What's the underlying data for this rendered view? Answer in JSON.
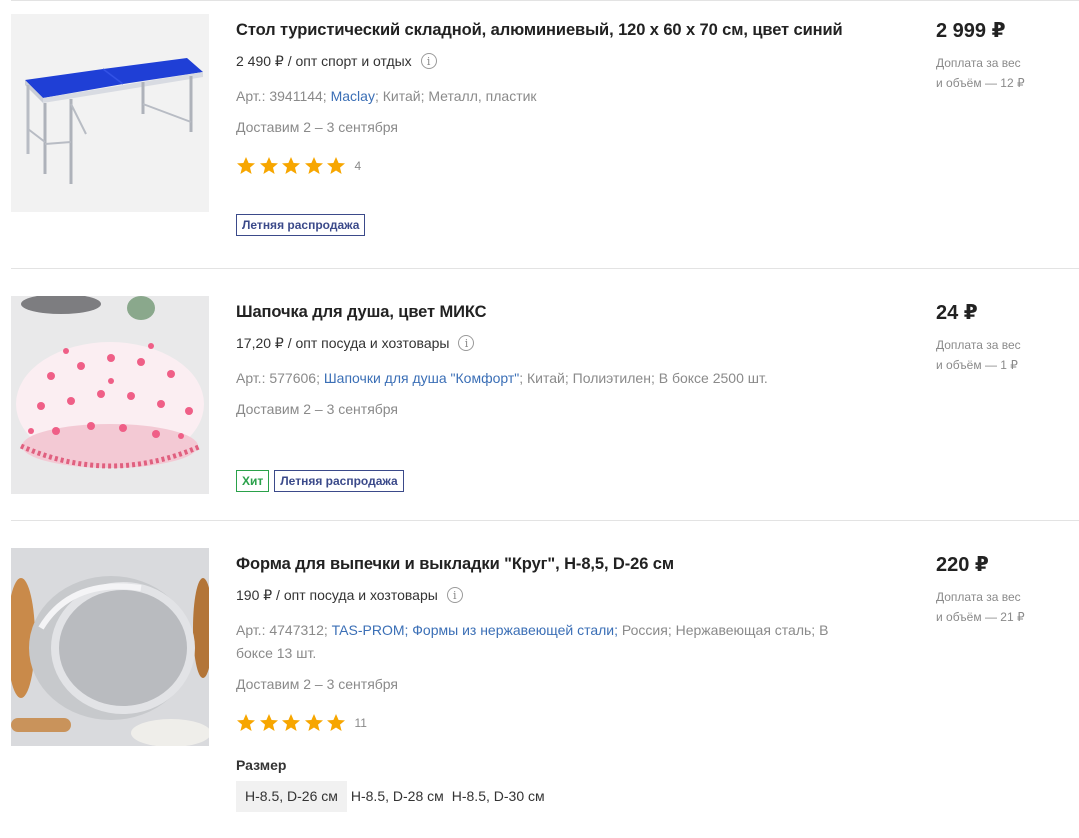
{
  "currency_sign": "₽",
  "products": [
    {
      "title": "Стол туристический складной, алюминиевый, 120 х 60 х 70 см, цвет синий",
      "opt_price": "2 490 ₽ / опт спорт и отдых",
      "info_glyph": "i",
      "article": "Арт.: 3941144;",
      "brand": "Maclay",
      "country": "Китай;",
      "material": "Металл, пластик",
      "delivery": "Доставим 2 – 3 сентября",
      "rating": 5,
      "rating_count": "4",
      "badges": [
        "Летняя распродажа"
      ],
      "price": "2 999 ₽",
      "surcharge_line1": "Доплата за вес",
      "surcharge_line2": "и объём — 12 ₽"
    },
    {
      "title": "Шапочка для душа, цвет МИКС",
      "opt_price": "17,20 ₽ / опт посуда и хозтовары",
      "info_glyph": "i",
      "article": "Арт.: 577606;",
      "brand": "Шапочки для душа \"Комфорт\"",
      "country": "Китай;",
      "material": "Полиэтилен;",
      "box": "В боксе 2500 шт.",
      "delivery": "Доставим 2 – 3 сентября",
      "badge_hit": "Хит",
      "badge_sale": "Летняя распродажа",
      "price": "24 ₽",
      "surcharge_line1": "Доплата за вес",
      "surcharge_line2": "и объём — 1 ₽"
    },
    {
      "title": "Форма для выпечки и выкладки \"Круг\", H-8,5, D-26 см",
      "opt_price": "190 ₽ / опт посуда и хозтовары",
      "info_glyph": "i",
      "article": "Арт.: 4747312;",
      "brand": "TAS-PROM;",
      "category": "Формы из нержавеющей стали;",
      "country": "Россия;",
      "material": "Нержавеющая сталь;",
      "box": "В боксе 13 шт.",
      "delivery": "Доставим 2 – 3 сентября",
      "rating": 5,
      "rating_count": "11",
      "size_label": "Размер",
      "sizes": [
        "H-8.5, D-26 см",
        "H-8.5, D-28 см",
        "H-8.5, D-30 см"
      ],
      "selected_size": "H-8.5, D-26 см",
      "price": "220 ₽",
      "surcharge_line1": "Доплата за вес",
      "surcharge_line2": "и объём — 21 ₽"
    }
  ],
  "colors": {
    "star": "#f7a600",
    "link": "#3b6fb6",
    "badge_sale": "#3b4a8a",
    "badge_hit": "#2aa14a",
    "muted": "#8a8a8a"
  },
  "icons": {
    "star": "star-icon",
    "info": "info-icon"
  }
}
